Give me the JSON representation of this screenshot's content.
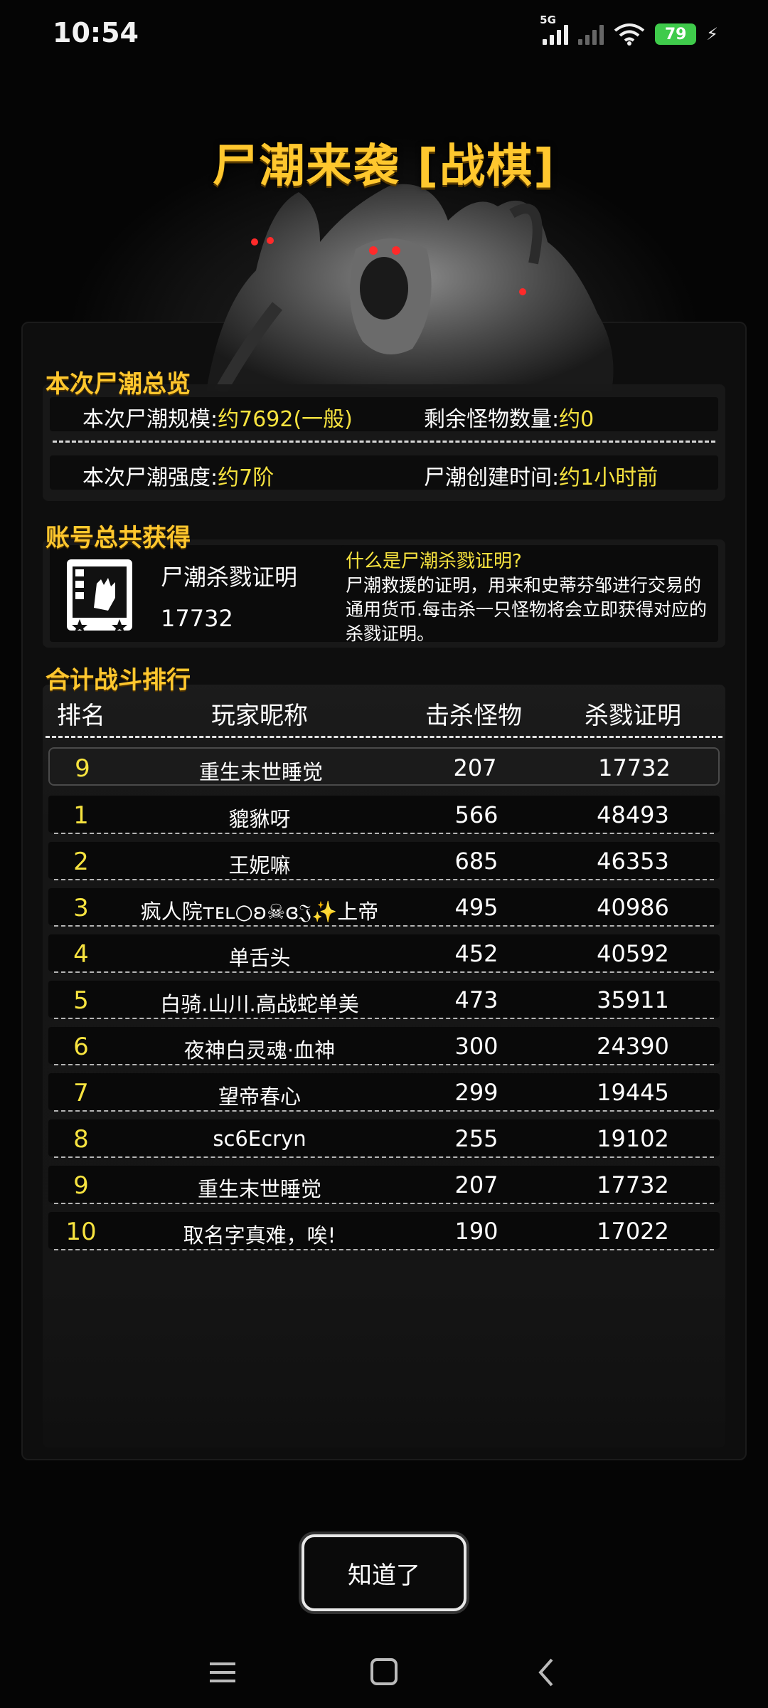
{
  "status_bar": {
    "time": "10:54",
    "network": "5G",
    "battery": "79"
  },
  "title": "尸潮来袭 [战棋]",
  "overview": {
    "section_label": "本次尸潮总览",
    "scale_label": "本次尸潮规模:",
    "scale_value": "约7692(一般)",
    "remaining_label": "剩余怪物数量:",
    "remaining_value": "约0",
    "strength_label": "本次尸潮强度:",
    "strength_value": "约7阶",
    "created_label": "尸潮创建时间:",
    "created_value": "约1小时前"
  },
  "account": {
    "section_label": "账号总共获得",
    "item_name": "尸潮杀戮证明",
    "item_value": "17732",
    "info_title": "什么是尸潮杀戮证明?",
    "info_body": "尸潮救援的证明，用来和史蒂芬邹进行交易的通用货币.每击杀一只怪物将会立即获得对应的杀戮证明。"
  },
  "ranking": {
    "section_label": "合计战斗排行",
    "headers": {
      "rank": "排名",
      "name": "玩家昵称",
      "kills": "击杀怪物",
      "proof": "杀戮证明"
    },
    "mine": {
      "rank": "9",
      "name": "重生末世睡觉",
      "kills": "207",
      "proof": "17732"
    },
    "rows": [
      {
        "rank": "1",
        "name": "貔貅呀",
        "kills": "566",
        "proof": "48493"
      },
      {
        "rank": "2",
        "name": "王妮嘛",
        "kills": "685",
        "proof": "46353"
      },
      {
        "rank": "3",
        "name": "疯人院ᴛᴇʟ○ʚ☠ɞ𝔍✨上帝",
        "kills": "495",
        "proof": "40986"
      },
      {
        "rank": "4",
        "name": "单舌头",
        "kills": "452",
        "proof": "40592"
      },
      {
        "rank": "5",
        "name": "白骑.山川.高战蛇单美",
        "kills": "473",
        "proof": "35911"
      },
      {
        "rank": "6",
        "name": "夜神白灵魂·血神",
        "kills": "300",
        "proof": "24390"
      },
      {
        "rank": "7",
        "name": "望帝春心",
        "kills": "299",
        "proof": "19445"
      },
      {
        "rank": "8",
        "name": "sc6Ecryn",
        "kills": "255",
        "proof": "19102"
      },
      {
        "rank": "9",
        "name": "重生末世睡觉",
        "kills": "207",
        "proof": "17732"
      },
      {
        "rank": "10",
        "name": "取名字真难，唉!",
        "kills": "190",
        "proof": "17022"
      }
    ]
  },
  "confirm_button": "知道了",
  "icons": {
    "menu": "menu-icon",
    "home": "home-icon",
    "back": "back-icon",
    "wifi": "wifi-icon",
    "bolt": "charging-bolt-icon"
  },
  "colors": {
    "title_gold": "#ffc72e",
    "value_yellow": "#f7e33f",
    "battery_green": "#3fcb4b"
  }
}
